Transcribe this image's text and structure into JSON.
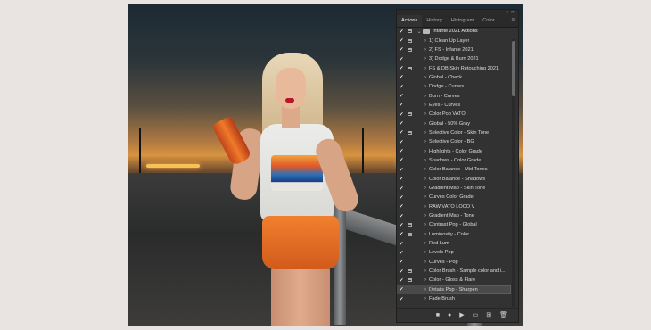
{
  "panel": {
    "tabs": [
      {
        "label": "Actions",
        "active": true
      },
      {
        "label": "History",
        "active": false
      },
      {
        "label": "Histogram",
        "active": false
      },
      {
        "label": "Color",
        "active": false
      }
    ],
    "window_controls": {
      "collapse": "«",
      "close": "✕"
    },
    "menu_icon": "≡",
    "set_name": "Infante 2021 Actions",
    "actions": [
      {
        "label": "1) Clean Up Layer",
        "dialog": true
      },
      {
        "label": "2) FS - Infante 2021",
        "dialog": true
      },
      {
        "label": "3) Dodge & Burn 2021",
        "dialog": false
      },
      {
        "label": "FS & DB Skin Retouching 2021",
        "dialog": true
      },
      {
        "label": "Global - Check",
        "dialog": false
      },
      {
        "label": "Dodge - Curves",
        "dialog": false
      },
      {
        "label": "Burn - Curves",
        "dialog": false
      },
      {
        "label": "Eyes - Curves",
        "dialog": false
      },
      {
        "label": "Color Pop VATO",
        "dialog": true
      },
      {
        "label": "Global - 50% Gray",
        "dialog": false
      },
      {
        "label": "Selective Color - Skin Tone",
        "dialog": true
      },
      {
        "label": "Selective Color - BG",
        "dialog": false
      },
      {
        "label": "Highlights - Color Grade",
        "dialog": false
      },
      {
        "label": "Shadows - Color Grade",
        "dialog": false
      },
      {
        "label": "Color Balance - Mid Tones",
        "dialog": false
      },
      {
        "label": "Color Balance - Shadows",
        "dialog": false
      },
      {
        "label": "Gradient Map - Skin Tone",
        "dialog": false
      },
      {
        "label": "Curves Color Grade",
        "dialog": false
      },
      {
        "label": "RAW VATO LOCO V",
        "dialog": false
      },
      {
        "label": "Gradient Map - Tone",
        "dialog": false
      },
      {
        "label": "Contrast Pop - Global",
        "dialog": true
      },
      {
        "label": "Luminosity - Color",
        "dialog": true
      },
      {
        "label": "Red Lum",
        "dialog": false
      },
      {
        "label": "Levels Pop",
        "dialog": false
      },
      {
        "label": "Curves - Pop",
        "dialog": false
      },
      {
        "label": "Color Brush - Sample color and i...",
        "dialog": true
      },
      {
        "label": "Color - Gloss & Flare",
        "dialog": true
      },
      {
        "label": "Details Pop - Sharpen",
        "dialog": false,
        "selected": true
      },
      {
        "label": "Fade Brush",
        "dialog": false
      }
    ],
    "footer_buttons": [
      {
        "name": "stop-icon",
        "glyph": "■"
      },
      {
        "name": "record-icon",
        "glyph": "●"
      },
      {
        "name": "play-icon",
        "glyph": "▶"
      },
      {
        "name": "new-set-folder-icon",
        "glyph": "▭"
      },
      {
        "name": "new-action-icon",
        "glyph": "⊞"
      },
      {
        "name": "trash-icon",
        "glyph": "🗑"
      }
    ]
  },
  "colors": {
    "panel_bg": "#323232",
    "tab_bar": "#2a2a2a",
    "selected_row": "#4a4a4a",
    "page_bg": "#e9e4e1"
  }
}
